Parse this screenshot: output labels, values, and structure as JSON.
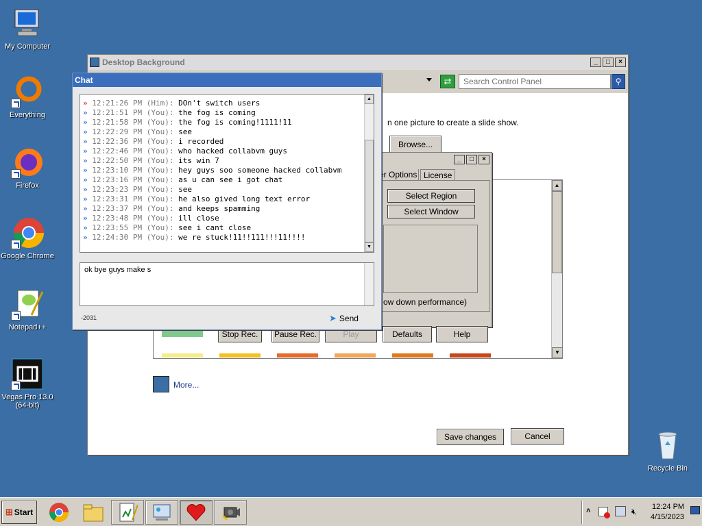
{
  "desktop": {
    "icons": [
      {
        "label": "My Computer"
      },
      {
        "label": "Everything"
      },
      {
        "label": "Firefox"
      },
      {
        "label": "Google Chrome"
      },
      {
        "label": "Notepad++"
      },
      {
        "label": "Vegas Pro 13.0 (64-bit)"
      },
      {
        "label": "Recycle Bin"
      }
    ]
  },
  "control_panel": {
    "title": "Desktop Background",
    "search_placeholder": "Search Control Panel",
    "instruction": "n one picture to create a slide show.",
    "browse": "Browse...",
    "more": "More...",
    "save": "Save changes",
    "cancel": "Cancel"
  },
  "recorder": {
    "tab_options": "er Options",
    "tab_license": "License",
    "select_region": "Select Region",
    "select_window": "Select Window",
    "perf_note": "ow down performance)",
    "stop": "Stop Rec.",
    "pause": "Pause Rec.",
    "play": "Play",
    "defaults": "Defaults",
    "help": "Help"
  },
  "chat": {
    "title": "Chat",
    "messages": [
      {
        "time": "12:21:26 PM",
        "who": "(Him):",
        "text": "DOn't switch users",
        "mine": false
      },
      {
        "time": "12:21:51 PM",
        "who": "(You):",
        "text": "the fog is coming",
        "mine": true
      },
      {
        "time": "12:21:58 PM",
        "who": "(You):",
        "text": "the fog is coming!1111!11",
        "mine": true
      },
      {
        "time": "12:22:29 PM",
        "who": "(You):",
        "text": "see",
        "mine": true
      },
      {
        "time": "12:22:36 PM",
        "who": "(You):",
        "text": "i recorded",
        "mine": true
      },
      {
        "time": "12:22:46 PM",
        "who": "(You):",
        "text": "who hacked collabvm guys",
        "mine": true
      },
      {
        "time": "12:22:50 PM",
        "who": "(You):",
        "text": "its win 7",
        "mine": true
      },
      {
        "time": "12:23:10 PM",
        "who": "(You):",
        "text": "hey guys soo someone hacked collabvm",
        "mine": true
      },
      {
        "time": "12:23:16 PM",
        "who": "(You):",
        "text": "as u can see i got chat",
        "mine": true
      },
      {
        "time": "12:23:23 PM",
        "who": "(You):",
        "text": "see",
        "mine": true
      },
      {
        "time": "12:23:31 PM",
        "who": "(You):",
        "text": "he also gived long text error",
        "mine": true
      },
      {
        "time": "12:23:37 PM",
        "who": "(You):",
        "text": "and keeps spamming",
        "mine": true
      },
      {
        "time": "12:23:48 PM",
        "who": "(You):",
        "text": "ill close",
        "mine": true
      },
      {
        "time": "12:23:55 PM",
        "who": "(You):",
        "text": "see i cant close",
        "mine": true
      },
      {
        "time": "12:24:30 PM",
        "who": "(You):",
        "text": "we re stuck!11!!111!!!11!!!!",
        "mine": true
      }
    ],
    "input_value": "ok bye guys make s",
    "counter": "-2031",
    "send": "Send"
  },
  "taskbar": {
    "start": "Start",
    "time": "12:24 PM",
    "date": "4/15/2023"
  },
  "colors": {
    "desktop": "#3a6ea5",
    "accent_swatch": "#3a6ea5",
    "swatches": [
      "#7fc98f",
      "#f5ec8c",
      "#f5c022",
      "#e86a2a",
      "#f2a65a",
      "#e07a1e",
      "#c8461a"
    ]
  }
}
